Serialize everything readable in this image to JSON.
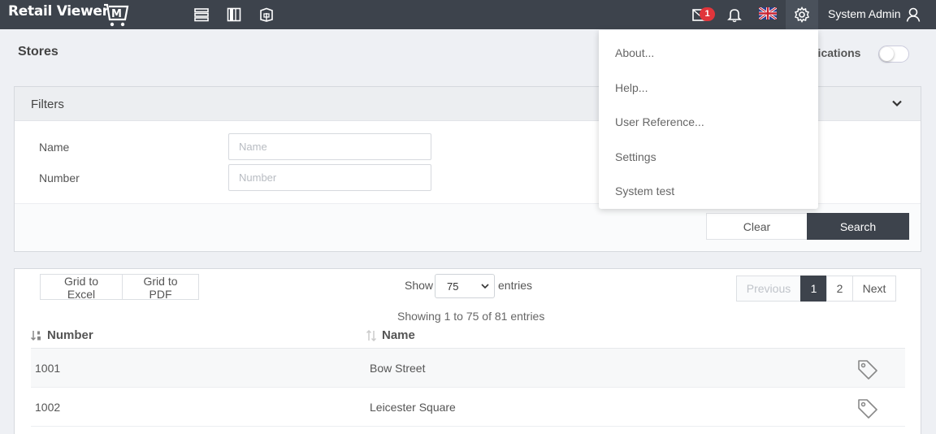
{
  "app": {
    "title": "Retail Viewer",
    "logo_letter": "M"
  },
  "topbar": {
    "icons": [
      "list-icon",
      "columns-icon",
      "box-icon"
    ],
    "mail_badge": "1",
    "user_name": "System Admin"
  },
  "page": {
    "title": "Stores",
    "notifications_label": "ifications"
  },
  "filters": {
    "title": "Filters",
    "name_label": "Name",
    "name_placeholder": "Name",
    "number_label": "Number",
    "number_placeholder": "Number",
    "clear_label": "Clear",
    "search_label": "Search"
  },
  "grid": {
    "excel_label": "Grid to Excel",
    "pdf_label": "Grid to PDF",
    "show_label": "Show",
    "page_size": "75",
    "entries_label": "entries",
    "pager": {
      "previous": "Previous",
      "page1": "1",
      "page2": "2",
      "next": "Next"
    },
    "showing": "Showing 1 to 75 of 81 entries",
    "columns": {
      "number": "Number",
      "name": "Name"
    },
    "rows": [
      {
        "number": "1001",
        "name": "Bow Street"
      },
      {
        "number": "1002",
        "name": "Leicester Square"
      }
    ]
  },
  "settings_menu": {
    "items": [
      "About...",
      "Help...",
      "User Reference...",
      "Settings",
      "System test"
    ]
  },
  "colors": {
    "topbar": "#3d434c",
    "badge": "#e0353b",
    "accent": "#3d434c"
  }
}
